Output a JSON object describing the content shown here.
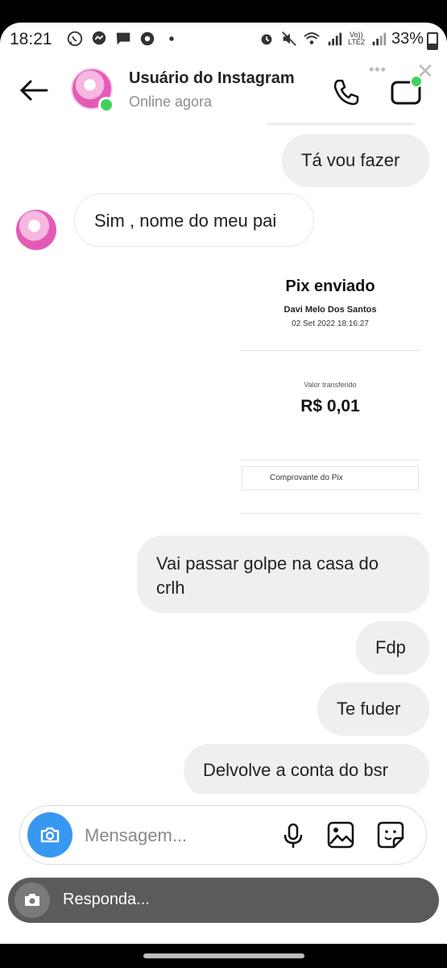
{
  "status_bar": {
    "time": "18:21",
    "network_label_top": "Vo))",
    "network_label_bottom": "LTE2",
    "battery": "33%"
  },
  "header": {
    "name": "Usuário do Instagram",
    "status": "Online agora",
    "accent": "#3cd35a"
  },
  "messages": [
    {
      "from": "me",
      "text": "Tá vou fazer"
    },
    {
      "from": "them",
      "text": "Sim , nome do meu pai"
    },
    {
      "from": "me",
      "type": "image",
      "pix": {
        "title": "Pix enviado",
        "payee": "Davi Melo Dos Santos",
        "datetime": "02 Set 2022 18:16:27",
        "value_label": "Valor transferido",
        "amount": "R$ 0,01",
        "receipt_button": "Comprovante do Pix"
      }
    },
    {
      "from": "me",
      "text_line1": "Vai passar golpe na casa do",
      "text_line2": "crlh"
    },
    {
      "from": "me",
      "text": "Fdp"
    },
    {
      "from": "me",
      "text": "Te fuder"
    },
    {
      "from": "me",
      "text": "Delvolve a conta do bsr"
    }
  ],
  "composer": {
    "placeholder": "Mensagem...",
    "camera_color": "#3897f0",
    "icons": [
      "camera-icon",
      "microphone-icon",
      "gallery-icon",
      "sticker-icon"
    ]
  },
  "reply_bar": {
    "placeholder": "Responda..."
  }
}
